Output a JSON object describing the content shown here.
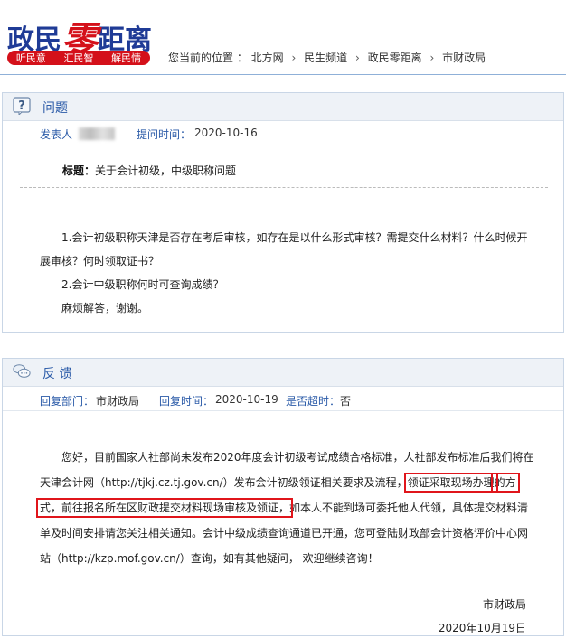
{
  "header": {
    "logo_part1": "政民",
    "logo_part2": "零",
    "logo_part3": "距离",
    "logo_tags": [
      "听民意",
      "汇民智",
      "解民情"
    ],
    "location_label": "您当前的位置 ：",
    "breadcrumb": [
      "北方网",
      "民生频道",
      "政民零距离",
      "市财政局"
    ],
    "breadcrumb_sep": "›"
  },
  "question": {
    "section_title": "问题",
    "poster_label": "发表人",
    "time_label": "提问时间：",
    "time_value": "2020-10-16",
    "title_label": "标题：",
    "title_value": "关于会计初级，中级职称问题",
    "paragraphs": [
      "1.会计初级职称天津是否存在考后审核，如存在是以什么形式审核？需提交什么材料？什么时候开展审核？何时领取证书？",
      "2.会计中级职称何时可查询成绩？",
      "麻烦解答，谢谢。"
    ]
  },
  "answer": {
    "section_title": "反 馈",
    "dept_label": "回复部门：",
    "dept_value": "市财政局",
    "time_label": "回复时间：",
    "time_value": "2020-10-19",
    "overdue_label": "是否超时：",
    "overdue_value": "否",
    "text_before": "您好，目前国家人社部尚未发布2020年度会计初级考试成绩合格标准，人社部发布标准后我们将在天津会计网（http://tjkj.cz.tj.gov.cn/）发布会计初级领证相关要求及流程，",
    "text_highlight_1": "领证采取现场办理",
    "text_highlight_2": "的方式，前往报名所在区财政提交材料现场审核及领证，",
    "text_after": "如本人不能到场可委托他人代领，具体提交材料清单及时间安排请您关注相关通知。会计中级成绩查询通道已开通，您可登陆财政部会计资格评价中心网站（http://kzp.mof.gov.cn/）查询，如有其他疑问， 欢迎继续咨询！",
    "signature": "市财政局",
    "date": "2020年10月19日"
  }
}
